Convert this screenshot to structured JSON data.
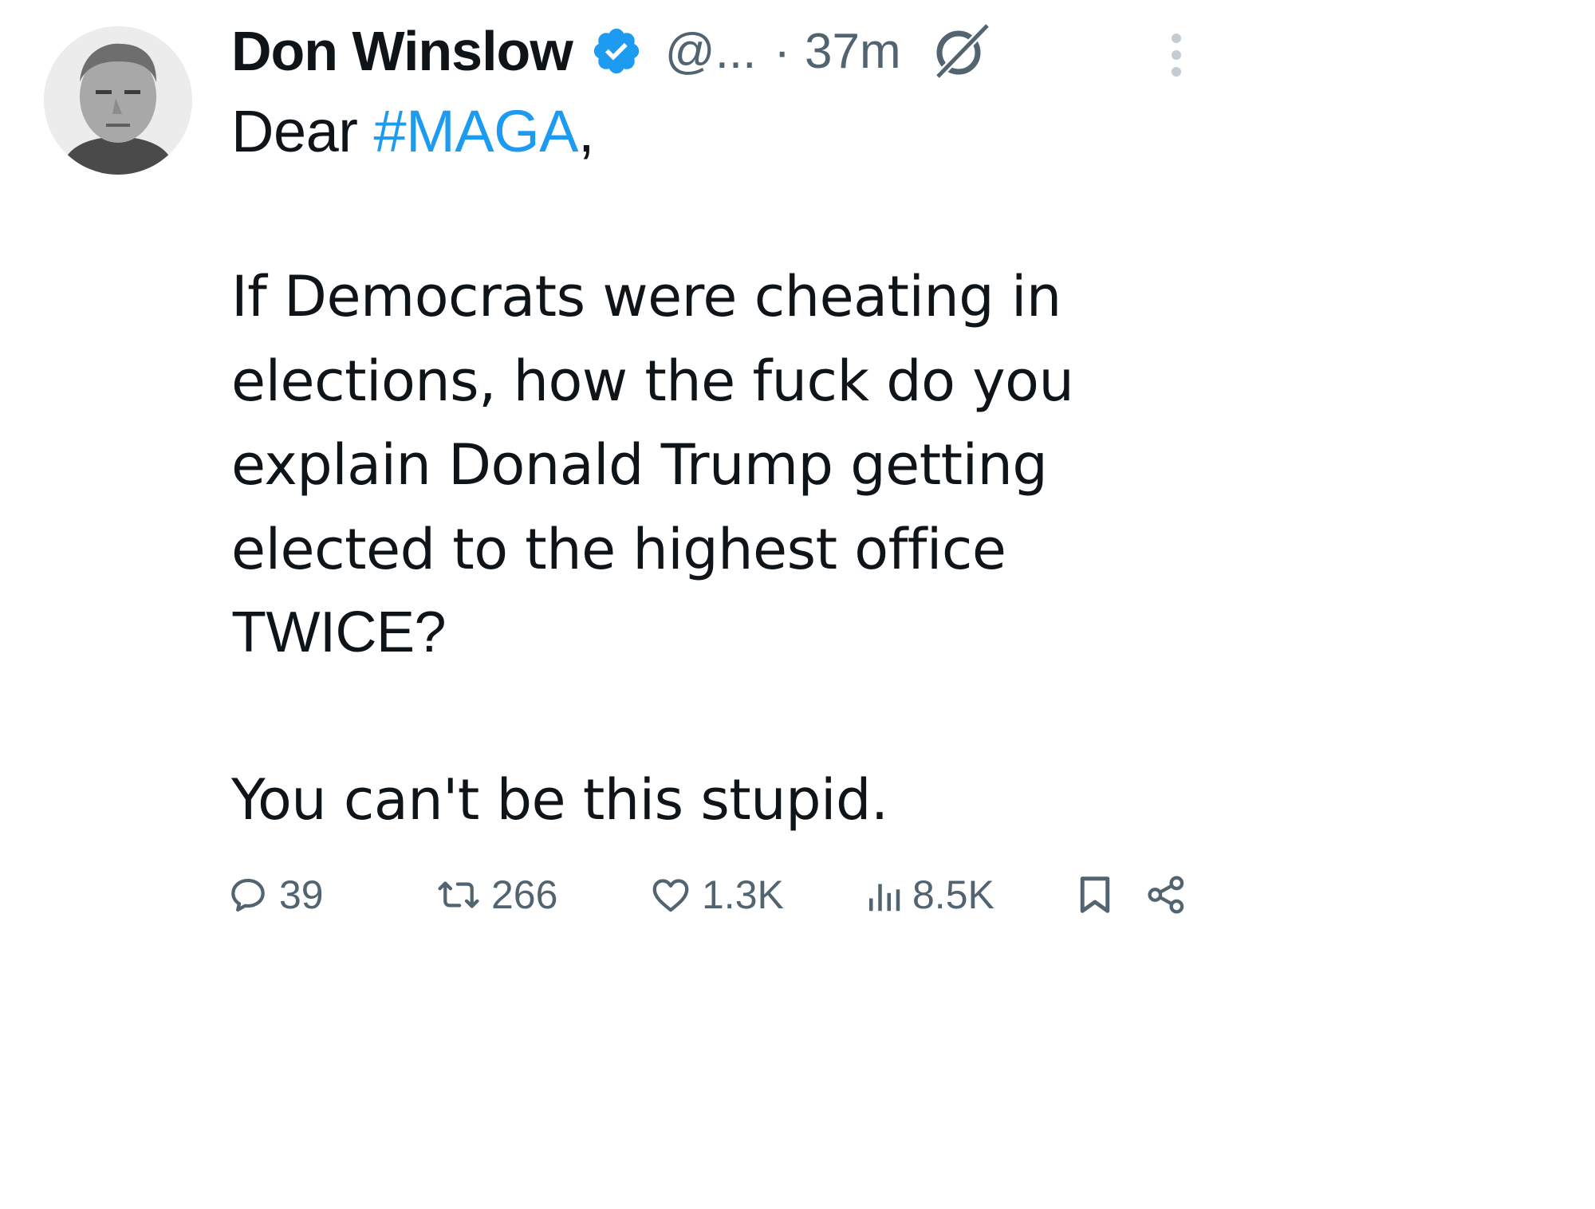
{
  "tweet": {
    "author_name": "Don Winslow",
    "handle": "@...",
    "separator": "·",
    "time": "37m",
    "greeting_prefix": "Dear ",
    "hashtag": "#MAGA",
    "greeting_suffix": ",",
    "body_lines": [
      "If Democrats were cheating in",
      "elections, how the fuck do you",
      "explain Donald Trump getting",
      "elected to the highest office",
      "TWICE?",
      "You can't be this stupid."
    ]
  },
  "actions": {
    "replies": "39",
    "reposts": "266",
    "likes": "1.3K",
    "views": "8.5K"
  },
  "icons": {
    "verified": "verified-badge-icon",
    "grok": "grok-icon",
    "more": "more-options-icon",
    "reply": "reply-icon",
    "repost": "repost-icon",
    "like": "heart-icon",
    "views": "views-chart-icon",
    "bookmark": "bookmark-icon",
    "share": "share-icon"
  },
  "colors": {
    "text": "#0f1419",
    "secondary": "#536471",
    "accent": "#1d9bf0"
  }
}
